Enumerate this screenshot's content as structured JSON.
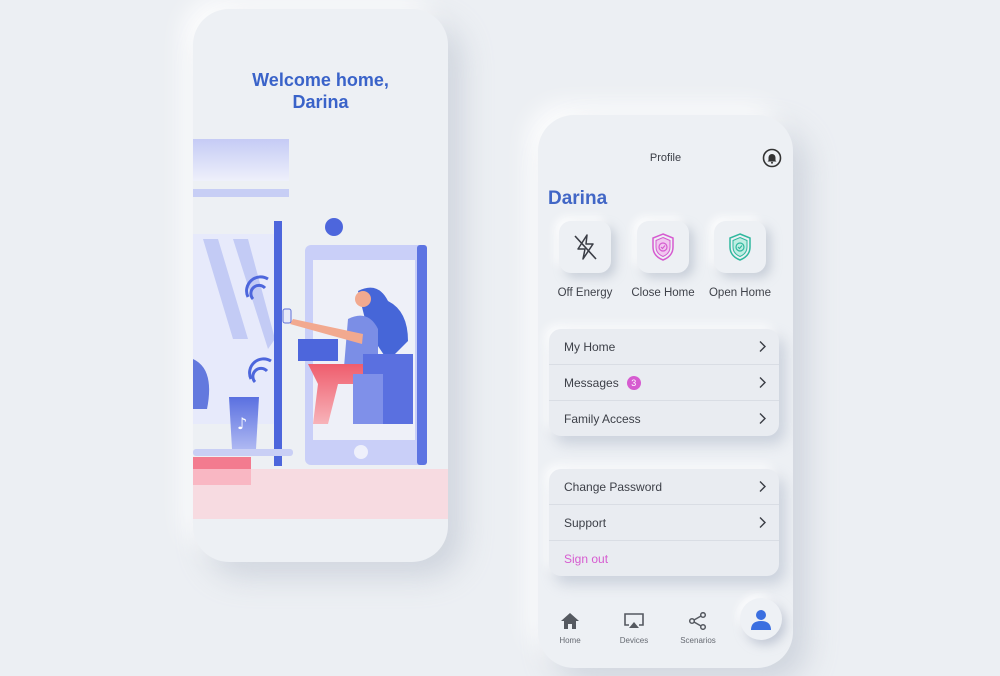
{
  "welcome_screen": {
    "greeting_line1": "Welcome home,",
    "greeting_line2": "Darina"
  },
  "profile_screen": {
    "header_title": "Profile",
    "user_name": "Darina",
    "quick_actions": [
      {
        "label": "Off Energy",
        "icon": "energy-off-icon"
      },
      {
        "label": "Close Home",
        "icon": "shield-check-icon",
        "color": "#d65bd0"
      },
      {
        "label": "Open Home",
        "icon": "shield-check-icon",
        "color": "#2fb89e"
      }
    ],
    "menu_group_1": [
      {
        "label": "My Home"
      },
      {
        "label": "Messages",
        "badge": "3"
      },
      {
        "label": "Family Access"
      }
    ],
    "menu_group_2": [
      {
        "label": "Change Password"
      },
      {
        "label": "Support"
      }
    ],
    "sign_out_label": "Sign out",
    "tabs": [
      {
        "label": "Home",
        "icon": "home-icon"
      },
      {
        "label": "Devices",
        "icon": "airplay-icon"
      },
      {
        "label": "Scenarios",
        "icon": "share-icon"
      }
    ],
    "active_tab": "profile"
  },
  "colors": {
    "accent": "#3a63c9",
    "pink": "#d65bd0",
    "teal": "#2fb89e"
  }
}
